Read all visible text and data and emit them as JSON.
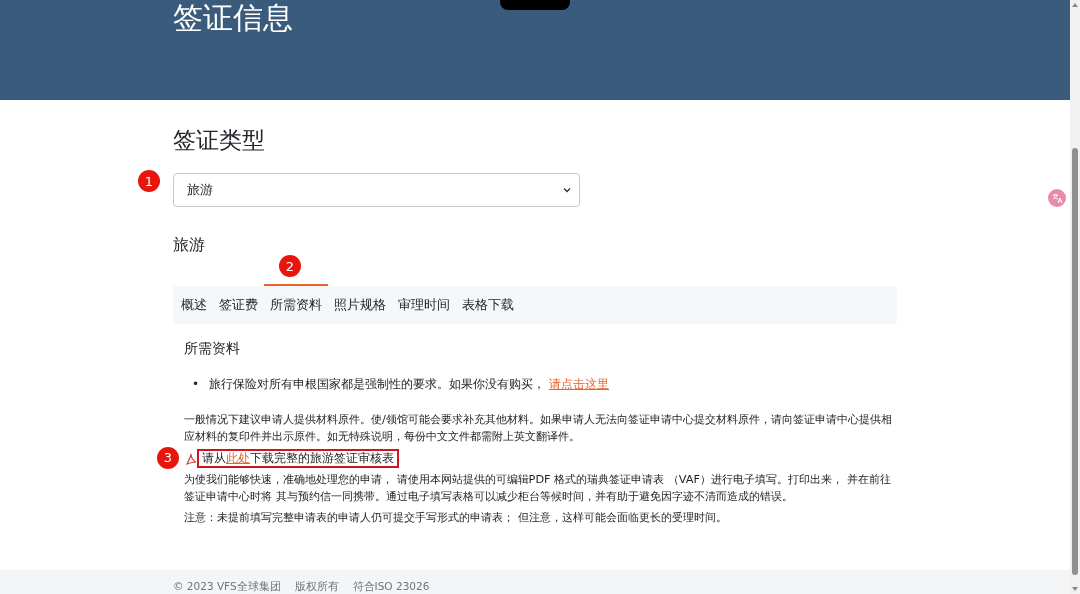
{
  "header": {
    "title": "签证信息"
  },
  "section_title": "签证类型",
  "visa_select": {
    "value": "旅游",
    "annotation": "1"
  },
  "visa_name": "旅游",
  "tabs_annotation": "2",
  "tabs": [
    {
      "label": "概述",
      "selected": false
    },
    {
      "label": "签证费",
      "selected": false
    },
    {
      "label": "所需资料",
      "selected": true
    },
    {
      "label": "照片规格",
      "selected": false
    },
    {
      "label": "审理时间",
      "selected": false
    },
    {
      "label": "表格下载",
      "selected": false
    }
  ],
  "panel": {
    "heading": "所需资料",
    "bullets": [
      {
        "marker": "•",
        "text": "旅行保险对所有申根国家都是强制性的要求。如果你没有购买，",
        "link": "请点击这里"
      }
    ],
    "intro": "一般情况下建议申请人提供材料原件。使/领馆可能会要求补充其他材料。如果申请人无法向签证申请中心提交材料原件，请向签证申请中心提供相应材料的复印件并出示原件。如无特殊说明，每份中文文件都需附上英文翻译件。",
    "download": {
      "before": "请从",
      "link": "此处",
      "after": "下载完整的旅游签证审核表",
      "annotation": "3"
    },
    "paragraphs": [
      "为使我们能够快速，准确地处理您的申请， 请使用本网站提供的可编辑PDF 格式的瑞典签证申请表 （VAF）进行电子填写。打印出来， 并在前往签证申请中心时将 其与预约信一同携带。通过电子填写表格可以减少柜台等候时间，并有助于避免因字迹不清而造成的错误。",
      "注意：未提前填写完整申请表的申请人仍可提交手写形式的申请表； 但注意，这样可能会面临更长的受理时间。"
    ]
  },
  "footer": {
    "items": [
      "© 2023 VFS全球集团",
      "版权所有",
      "符合ISO 23026"
    ]
  }
}
